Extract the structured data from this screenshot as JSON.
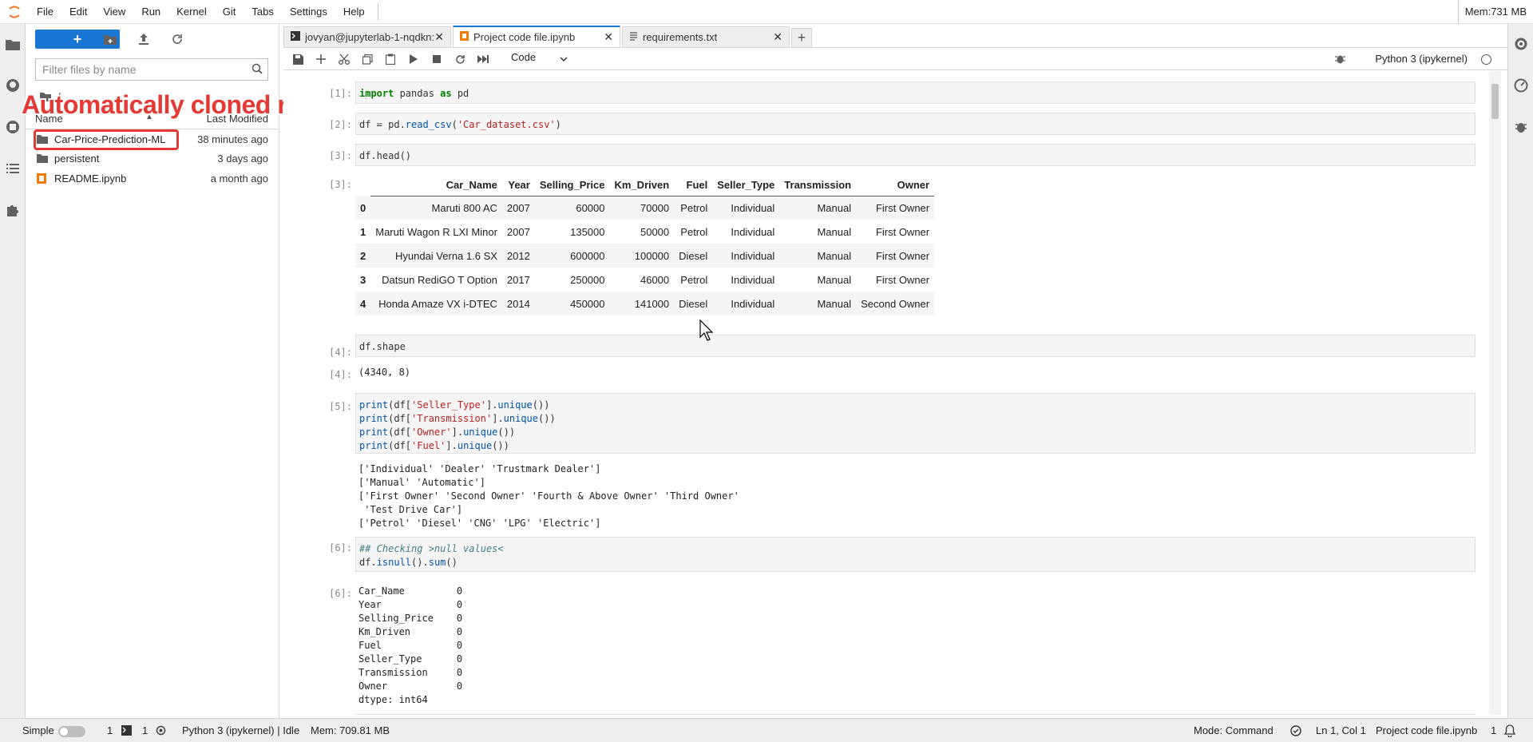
{
  "menubar": {
    "items": [
      "File",
      "Edit",
      "View",
      "Run",
      "Kernel",
      "Git",
      "Tabs",
      "Settings",
      "Help"
    ],
    "mem": "Mem:731 MB"
  },
  "filebrowser": {
    "new_label": "+",
    "filter_placeholder": "Filter files by name",
    "breadcrumb": "/",
    "col_name": "Name",
    "col_modified": "Last Modified",
    "files": [
      {
        "name": "Car-Price-Prediction-ML",
        "modified": "38 minutes ago",
        "icon": "folder-icon"
      },
      {
        "name": "persistent",
        "modified": "3 days ago",
        "icon": "folder-icon"
      },
      {
        "name": "README.ipynb",
        "modified": "a month ago",
        "icon": "notebook-icon"
      }
    ],
    "annotation": "Automatically cloned repo"
  },
  "tabs": [
    {
      "label": "jovyan@jupyterlab-1-nqdkn:",
      "icon": "terminal-icon",
      "active": false
    },
    {
      "label": "Project code file.ipynb",
      "icon": "notebook-icon",
      "active": true
    },
    {
      "label": "requirements.txt",
      "icon": "text-file-icon",
      "active": false
    }
  ],
  "toolbar": {
    "cell_type": "Code",
    "kernel": "Python 3 (ipykernel)"
  },
  "cells": {
    "c1": {
      "prompt": "[1]:"
    },
    "c2": {
      "prompt": "[2]:"
    },
    "c3": {
      "prompt": "[3]:",
      "code": "df.head()",
      "out_prompt": "[3]:"
    },
    "c4": {
      "prompt": "[4]:",
      "code": "df.shape",
      "out_prompt": "[4]:",
      "output": "(4340, 8)"
    },
    "c5": {
      "prompt": "[5]:",
      "output": "['Individual' 'Dealer' 'Trustmark Dealer']\n['Manual' 'Automatic']\n['First Owner' 'Second Owner' 'Fourth & Above Owner' 'Third Owner'\n 'Test Drive Car']\n['Petrol' 'Diesel' 'CNG' 'LPG' 'Electric']"
    },
    "c6": {
      "prompt": "[6]:",
      "out_prompt": "[6]:",
      "output": "Car_Name         0\nYear             0\nSelling_Price    0\nKm_Driven        0\nFuel             0\nSeller_Type      0\nTransmission     0\nOwner            0\ndtype: int64"
    }
  },
  "dataframe": {
    "columns": [
      "",
      "Car_Name",
      "Year",
      "Selling_Price",
      "Km_Driven",
      "Fuel",
      "Seller_Type",
      "Transmission",
      "Owner"
    ],
    "rows": [
      [
        "0",
        "Maruti 800 AC",
        "2007",
        "60000",
        "70000",
        "Petrol",
        "Individual",
        "Manual",
        "First Owner"
      ],
      [
        "1",
        "Maruti Wagon R LXI Minor",
        "2007",
        "135000",
        "50000",
        "Petrol",
        "Individual",
        "Manual",
        "First Owner"
      ],
      [
        "2",
        "Hyundai Verna 1.6 SX",
        "2012",
        "600000",
        "100000",
        "Diesel",
        "Individual",
        "Manual",
        "First Owner"
      ],
      [
        "3",
        "Datsun RediGO T Option",
        "2017",
        "250000",
        "46000",
        "Petrol",
        "Individual",
        "Manual",
        "First Owner"
      ],
      [
        "4",
        "Honda Amaze VX i-DTEC",
        "2014",
        "450000",
        "141000",
        "Diesel",
        "Individual",
        "Manual",
        "Second Owner"
      ]
    ]
  },
  "statusbar": {
    "mode": "Simple",
    "terminals": "1",
    "kernels": "1",
    "kernel_status": "Python 3 (ipykernel) | Idle",
    "mem": "Mem: 709.81 MB",
    "command_mode": "Mode: Command",
    "position": "Ln 1, Col 1",
    "filename": "Project code file.ipynb",
    "count": "1"
  },
  "colors": {
    "accent": "#1976d2",
    "annotation": "#e53935",
    "notebook_orange": "#f57c00"
  }
}
